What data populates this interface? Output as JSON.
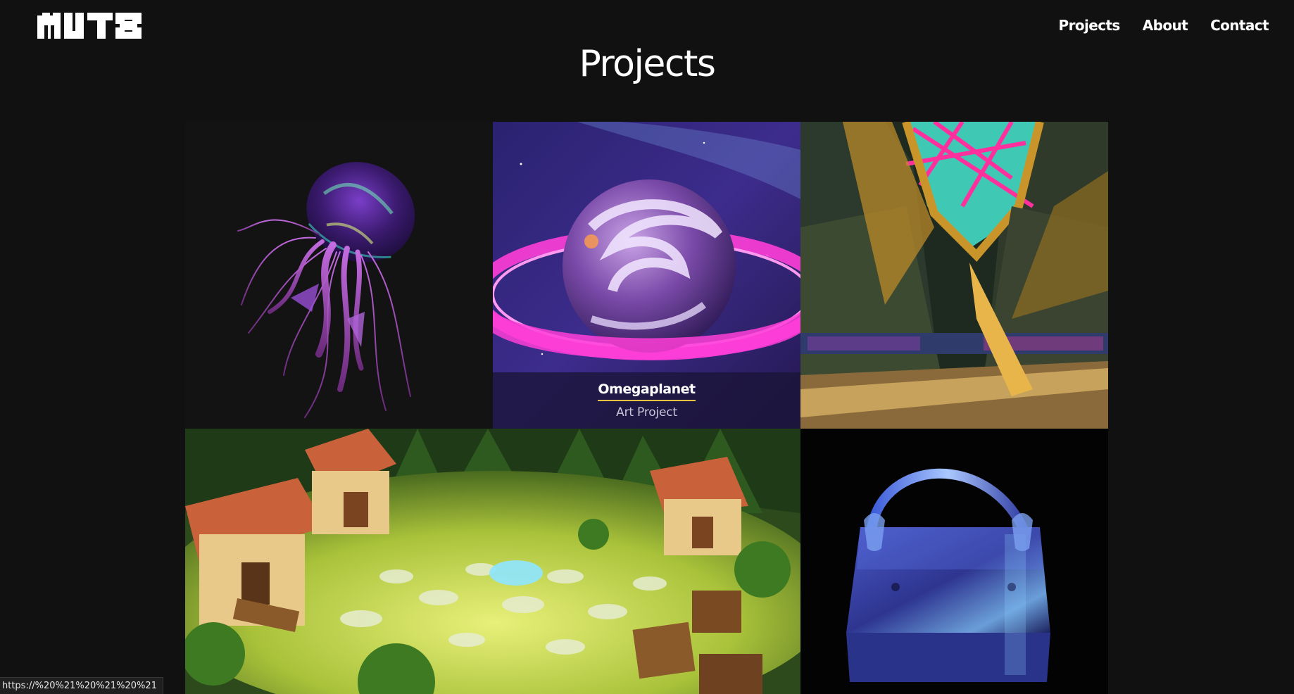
{
  "header": {
    "logo_alt": "MUTE",
    "nav": [
      {
        "label": "Projects"
      },
      {
        "label": "About"
      },
      {
        "label": "Contact"
      }
    ]
  },
  "main": {
    "title": "Projects",
    "projects": [
      {
        "image": "jellyfish"
      },
      {
        "image": "ringed-planet",
        "title": "Omegaplanet",
        "subtitle": "Art Project"
      },
      {
        "image": "golden-interior"
      },
      {
        "image": "village-clearing"
      },
      {
        "image": "glossy-handbag"
      }
    ]
  },
  "status_bar": {
    "url": "https://%20%21%20%21%20%21"
  },
  "colors": {
    "background": "#111111",
    "text": "#ffffff",
    "caption_underline": "#e6c23e",
    "caption_background": "#191437"
  }
}
